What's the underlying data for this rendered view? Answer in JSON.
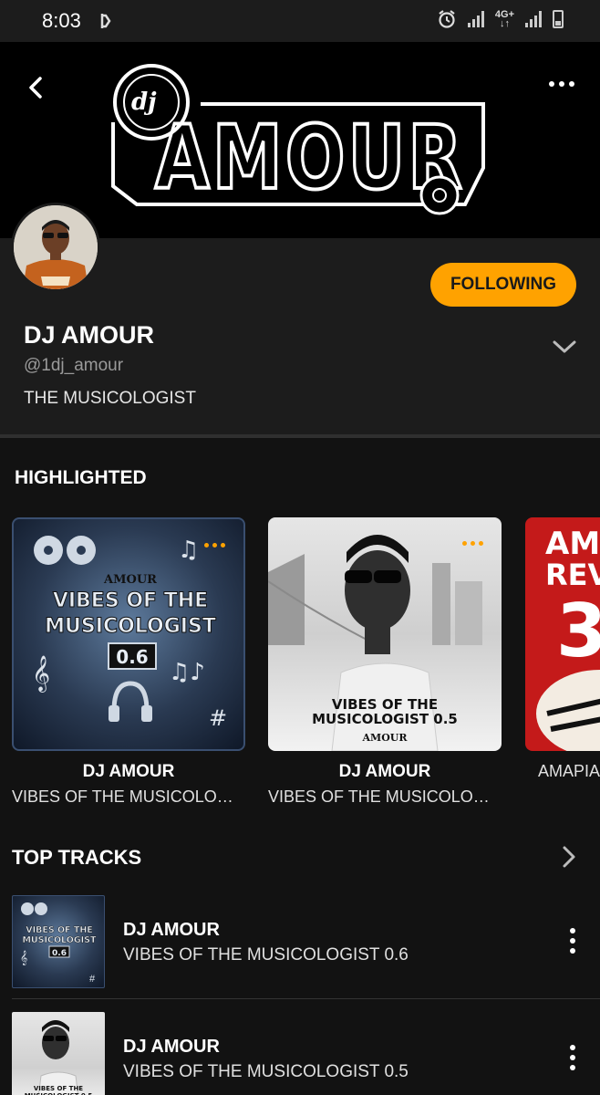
{
  "status_bar": {
    "time": "8:03",
    "network": "4G+"
  },
  "banner": {
    "logo_text": "AMOUR",
    "logo_prefix": "dj"
  },
  "profile": {
    "name": "DJ AMOUR",
    "handle": "@1dj_amour",
    "bio": "THE MUSICOLOGIST",
    "follow_label": "FOLLOWING",
    "accent_color": "#ffa200"
  },
  "highlighted": {
    "title": "HIGHLIGHTED",
    "items": [
      {
        "artist": "DJ AMOUR",
        "title": "VIBES OF THE MUSICOLOGIST...",
        "art_title_line1": "VIBES OF THE",
        "art_title_line2": "MUSICOLOGIST",
        "art_number": "0.6",
        "art_brand": "AMOUR"
      },
      {
        "artist": "DJ AMOUR",
        "title": "VIBES OF THE MUSICOLOGIST...",
        "art_title_line1": "VIBES OF THE",
        "art_title_line2": "MUSICOLOGIST 0.5",
        "art_brand": "AMOUR"
      },
      {
        "artist": "",
        "title": "AMAPIAI",
        "art_line1": "AMA",
        "art_line2": "REV",
        "art_line3": "3"
      }
    ]
  },
  "top_tracks": {
    "title": "TOP TRACKS",
    "items": [
      {
        "artist": "DJ AMOUR",
        "title": "VIBES OF THE MUSICOLOGIST 0.6"
      },
      {
        "artist": "DJ AMOUR",
        "title": "VIBES OF THE MUSICOLOGIST 0.5"
      }
    ]
  }
}
